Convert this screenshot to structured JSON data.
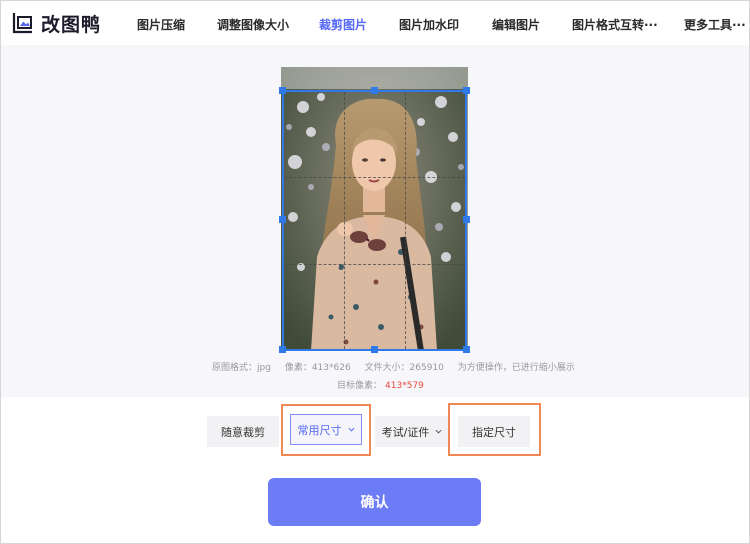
{
  "brand": {
    "name": "改图鸭"
  },
  "nav": {
    "items": [
      {
        "label": "图片压缩"
      },
      {
        "label": "调整图像大小"
      },
      {
        "label": "裁剪图片"
      },
      {
        "label": "图片加水印"
      },
      {
        "label": "编辑图片"
      },
      {
        "label": "图片格式互转···"
      },
      {
        "label": "更多工具···"
      }
    ],
    "active_index": 2
  },
  "image_info": {
    "format_label": "原图格式：jpg",
    "pixels_label": "像素：413*626",
    "filesize_label": "文件大小：265910",
    "note": "为方便操作，已进行缩小展示",
    "target_label": "目标像素：",
    "target_value": "413*579"
  },
  "options": {
    "free_crop": "随意裁剪",
    "common_size": "常用尺寸",
    "exam_id": "考试/证件",
    "custom_size": "指定尺寸"
  },
  "confirm_label": "确认",
  "colors": {
    "accent": "#5468f5",
    "crop_frame": "#2f7ae8",
    "confirm_bg": "#6c7bf6",
    "highlight": "#f08856",
    "target_value": "#e74c3c"
  },
  "icons": [
    "logo-icon",
    "chevron-down-icon"
  ]
}
